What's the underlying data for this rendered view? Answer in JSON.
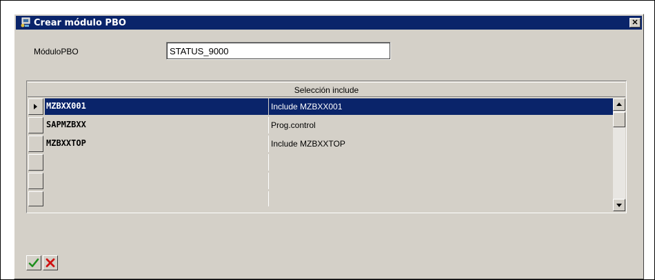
{
  "dialog": {
    "title": "Crear módulo PBO",
    "close_glyph": "✕"
  },
  "field": {
    "label": "MóduloPBO",
    "value": "STATUS_9000"
  },
  "table": {
    "header": "Selección include",
    "rows": [
      {
        "name": "MZBXX001",
        "description": "Include MZBXX001",
        "selected": true
      },
      {
        "name": "SAPMZBXX",
        "description": "Prog.control",
        "selected": false
      },
      {
        "name": "MZBXXTOP",
        "description": "Include MZBXXTOP",
        "selected": false
      },
      {
        "name": "",
        "description": "",
        "selected": false
      },
      {
        "name": "",
        "description": "",
        "selected": false
      },
      {
        "name": "",
        "description": "",
        "selected": false
      }
    ]
  },
  "buttons": {
    "confirm_icon": "checkmark-icon",
    "cancel_icon": "cancel-x-icon"
  },
  "colors": {
    "title_bar": "#0a246a",
    "selection": "#0a246a",
    "check": "#1f8f1f",
    "cancel": "#d01010"
  }
}
